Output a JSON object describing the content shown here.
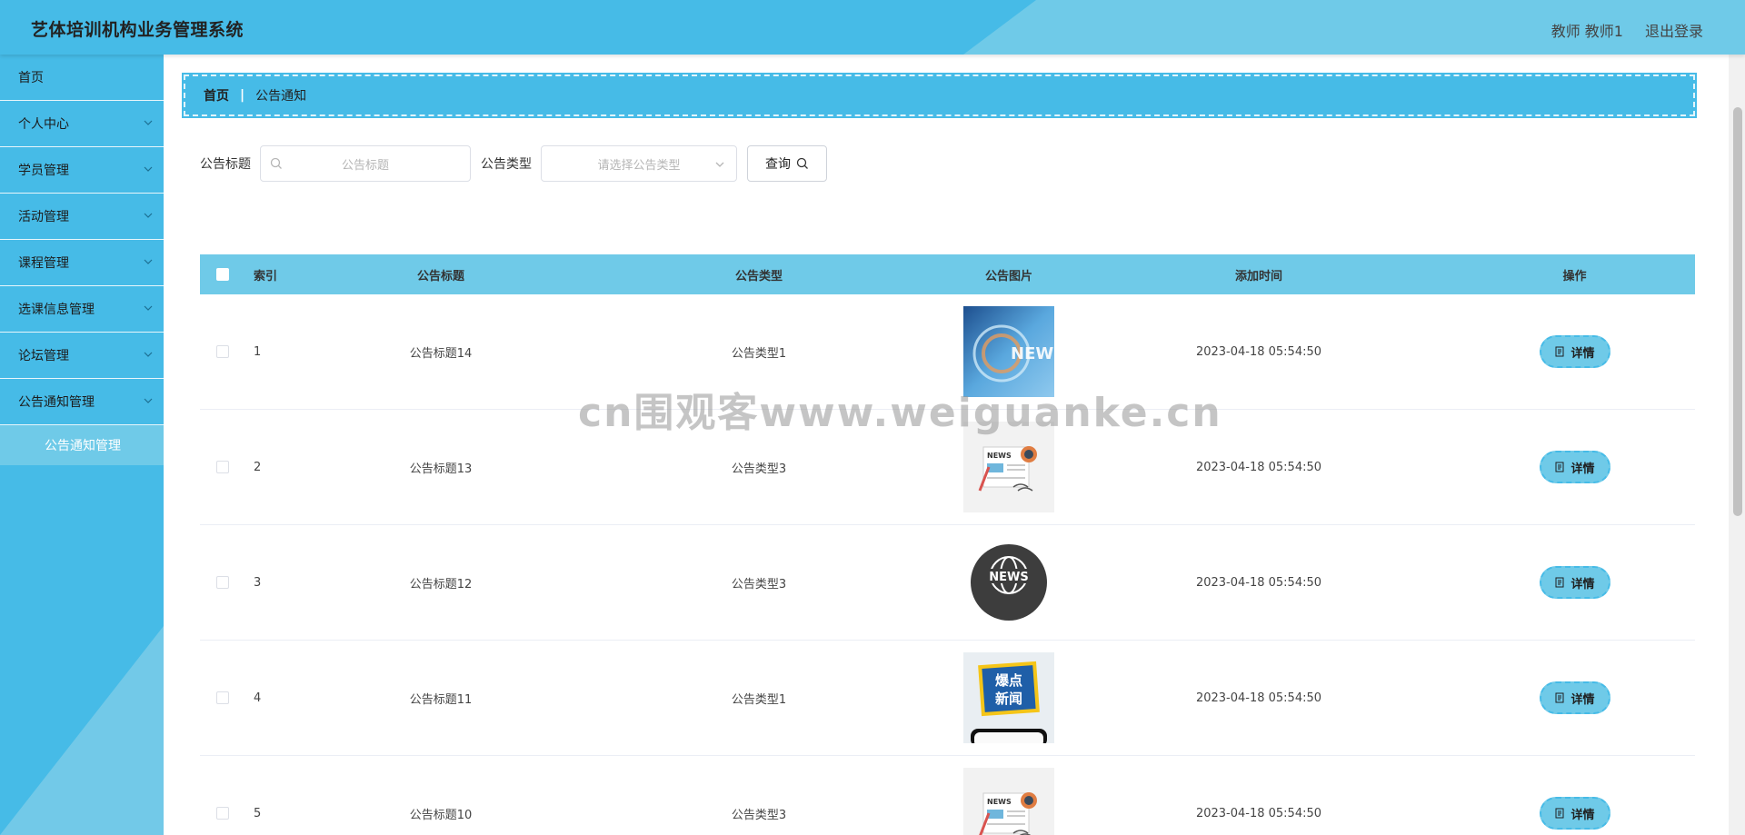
{
  "header": {
    "title": "艺体培训机构业务管理系统",
    "user": "教师 教师1",
    "logout": "退出登录"
  },
  "sidebar": {
    "items": [
      {
        "label": "首页",
        "expandable": false
      },
      {
        "label": "个人中心",
        "expandable": true
      },
      {
        "label": "学员管理",
        "expandable": true
      },
      {
        "label": "活动管理",
        "expandable": true
      },
      {
        "label": "课程管理",
        "expandable": true
      },
      {
        "label": "选课信息管理",
        "expandable": true
      },
      {
        "label": "论坛管理",
        "expandable": true
      },
      {
        "label": "公告通知管理",
        "expandable": true
      }
    ],
    "active_sub": "公告通知管理"
  },
  "breadcrumb": {
    "home": "首页",
    "current": "公告通知"
  },
  "search": {
    "title_label": "公告标题",
    "title_placeholder": "公告标题",
    "type_label": "公告类型",
    "type_placeholder": "请选择公告类型",
    "query_button": "查询"
  },
  "table": {
    "headers": {
      "index": "索引",
      "title": "公告标题",
      "type": "公告类型",
      "image": "公告图片",
      "time": "添加时间",
      "action": "操作"
    },
    "detail_label": "详情",
    "rows": [
      {
        "index": "1",
        "title": "公告标题14",
        "type": "公告类型1",
        "time": "2023-04-18 05:54:50"
      },
      {
        "index": "2",
        "title": "公告标题13",
        "type": "公告类型3",
        "time": "2023-04-18 05:54:50"
      },
      {
        "index": "3",
        "title": "公告标题12",
        "type": "公告类型3",
        "time": "2023-04-18 05:54:50"
      },
      {
        "index": "4",
        "title": "公告标题11",
        "type": "公告类型1",
        "time": "2023-04-18 05:54:50"
      },
      {
        "index": "5",
        "title": "公告标题10",
        "type": "公告类型3",
        "time": "2023-04-18 05:54:50"
      }
    ]
  },
  "images": {
    "news1": "NEWS",
    "news2": "NEWS",
    "news3": "NEWS",
    "hot1": "爆点",
    "hot2": "新闻",
    "news5": "NEWS"
  },
  "watermark": "cn围观客www.weiguanke.cn"
}
